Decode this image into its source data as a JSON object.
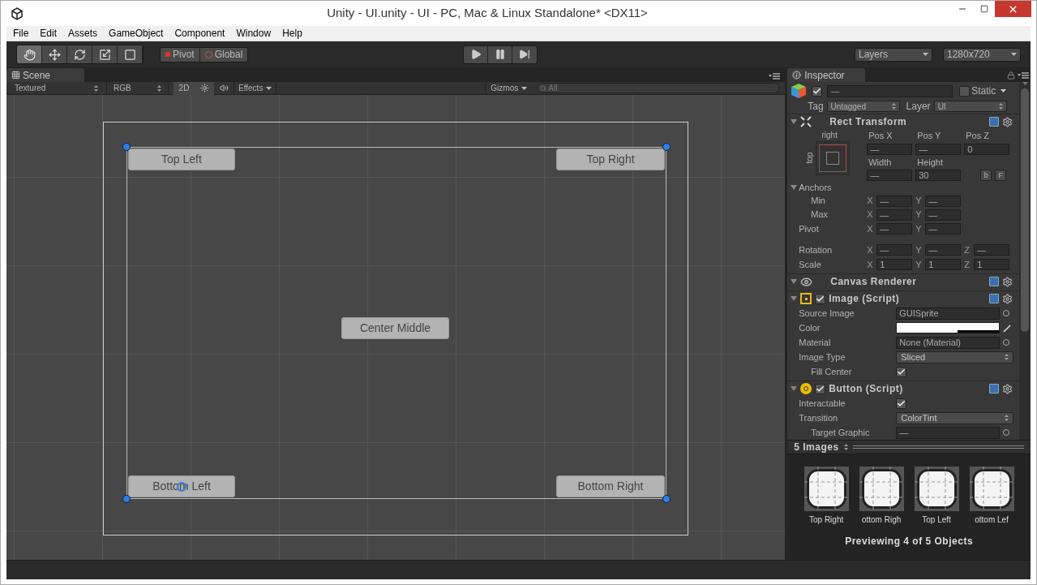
{
  "window": {
    "title": "Unity - UI.unity - UI - PC, Mac & Linux Standalone* <DX11>"
  },
  "menu": [
    "File",
    "Edit",
    "Assets",
    "GameObject",
    "Component",
    "Window",
    "Help"
  ],
  "toolbar": {
    "tools": [
      {
        "kind": "hand",
        "selected": true
      },
      {
        "kind": "move",
        "selected": false
      },
      {
        "kind": "rotate",
        "selected": false
      },
      {
        "kind": "scale",
        "selected": false
      },
      {
        "kind": "rect",
        "selected": false
      }
    ],
    "pivot": "Pivot",
    "global": "Global",
    "layers": "Layers",
    "layout": "1280x720"
  },
  "scene": {
    "tab": "Scene",
    "shading": "Textured",
    "channel": "RGB",
    "mode_2d": {
      "label": "2D",
      "on": true
    },
    "lighting": {
      "on": false
    },
    "audio": {
      "on": false
    },
    "effects": "Effects",
    "gizmos": "Gizmos",
    "search": {
      "placeholder": "All"
    },
    "buttons": [
      {
        "label": "Top Left"
      },
      {
        "label": "Top Right"
      },
      {
        "label": "Center Middle"
      },
      {
        "label": "Bottom Left"
      },
      {
        "label": "Bottom Right"
      }
    ]
  },
  "inspector": {
    "tab": "Inspector",
    "active": true,
    "name": "—",
    "static": {
      "label": "Static",
      "checked": false
    },
    "tag_label": "Tag",
    "tag": "Untagged",
    "layer_label": "Layer",
    "layer": "UI",
    "rect_transform": {
      "title": "Rect Transform",
      "expanded": true,
      "anchor_h": "right",
      "anchor_v": "top",
      "row1": [
        {
          "label": "Pos X",
          "value": "—"
        },
        {
          "label": "Pos Y",
          "value": "—"
        },
        {
          "label": "Pos Z",
          "value": "0"
        }
      ],
      "row2": [
        {
          "label": "Width",
          "value": "—"
        },
        {
          "label": "Height",
          "value": "30"
        }
      ],
      "blueprint": "b",
      "raw": "F",
      "anchors": {
        "label": "Anchors",
        "expanded": true,
        "rows": [
          {
            "label": "Min",
            "axes": [
              {
                "axis": "X",
                "value": "—"
              },
              {
                "axis": "Y",
                "value": "—"
              }
            ]
          },
          {
            "label": "Max",
            "axes": [
              {
                "axis": "X",
                "value": "—"
              },
              {
                "axis": "Y",
                "value": "—"
              }
            ]
          }
        ]
      },
      "rows": [
        {
          "label": "Pivot",
          "axes": [
            {
              "axis": "X",
              "value": "—"
            },
            {
              "axis": "Y",
              "value": "—"
            }
          ]
        },
        {
          "label": "Rotation",
          "axes": [
            {
              "axis": "X",
              "value": "—"
            },
            {
              "axis": "Y",
              "value": "—"
            },
            {
              "axis": "Z",
              "value": "—"
            }
          ]
        },
        {
          "label": "Scale",
          "axes": [
            {
              "axis": "X",
              "value": "1"
            },
            {
              "axis": "Y",
              "value": "1"
            },
            {
              "axis": "Z",
              "value": "1"
            }
          ]
        }
      ]
    },
    "components": [
      {
        "kind": "renderer",
        "title": "Canvas Renderer",
        "expanded": true
      },
      {
        "kind": "image",
        "title": "Image (Script)",
        "expanded": true,
        "enabled": true,
        "fields": [
          {
            "kind": "object",
            "label": "Source Image",
            "value": "GUISprite"
          },
          {
            "kind": "color",
            "label": "Color",
            "color": "#ffffff"
          },
          {
            "kind": "object",
            "label": "Material",
            "value": "None (Material)"
          },
          {
            "kind": "dropdown",
            "label": "Image Type",
            "value": "Sliced",
            "children": [
              {
                "kind": "checkbox",
                "label": "Fill Center",
                "checked": true
              }
            ]
          }
        ]
      },
      {
        "kind": "button",
        "title": "Button (Script)",
        "expanded": true,
        "enabled": true,
        "fields": [
          {
            "kind": "checkbox",
            "label": "Interactable",
            "checked": true
          },
          {
            "kind": "dropdown",
            "label": "Transition",
            "value": "ColorTint",
            "children": [
              {
                "kind": "object",
                "label": "Target Graphic",
                "value": "—"
              }
            ]
          }
        ]
      }
    ],
    "preview": {
      "title": "5 Images",
      "items": [
        "Top Right",
        "ottom Righ",
        "Top Left",
        "ottom Lef"
      ],
      "footer": "Previewing 4 of 5 Objects"
    }
  }
}
